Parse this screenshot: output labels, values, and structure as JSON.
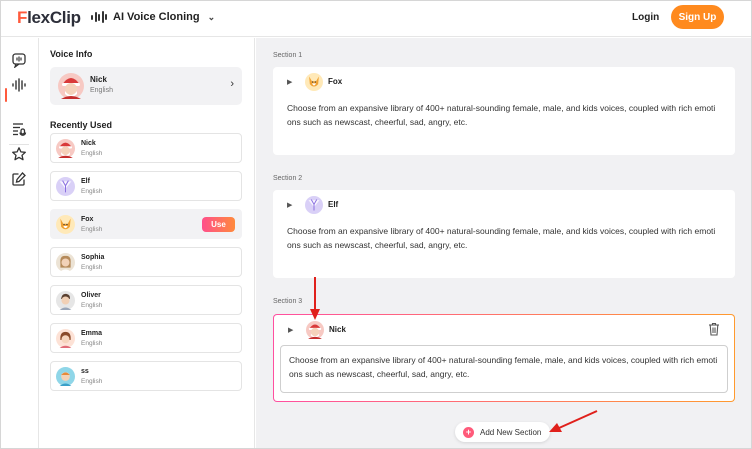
{
  "header": {
    "logo_prefix": "F",
    "logo_rest": "lexClip",
    "tool_name": "AI Voice Cloning",
    "login_label": "Login",
    "signup_label": "Sign Up"
  },
  "rail": {
    "items": [
      {
        "icon": "voice-chat-icon",
        "active": true
      },
      {
        "icon": "soundwave-icon",
        "active": false
      },
      {
        "icon": "script-icon",
        "active": false
      },
      {
        "icon": "star-icon",
        "active": false
      },
      {
        "icon": "edit-icon",
        "active": false
      }
    ]
  },
  "panel": {
    "voice_info_title": "Voice Info",
    "current_voice": {
      "name": "Nick",
      "lang": "English",
      "avatar": "nick"
    },
    "recent_title": "Recently Used",
    "use_label": "Use",
    "voices": [
      {
        "name": "Nick",
        "lang": "English",
        "avatar": "nick",
        "selected": false
      },
      {
        "name": "Elf",
        "lang": "English",
        "avatar": "elf",
        "selected": false
      },
      {
        "name": "Fox",
        "lang": "English",
        "avatar": "fox",
        "selected": true
      },
      {
        "name": "Sophia",
        "lang": "English",
        "avatar": "sophia",
        "selected": false
      },
      {
        "name": "Oliver",
        "lang": "English",
        "avatar": "oliver",
        "selected": false
      },
      {
        "name": "Emma",
        "lang": "English",
        "avatar": "emma",
        "selected": false
      },
      {
        "name": "ss",
        "lang": "English",
        "avatar": "ss",
        "selected": false
      }
    ]
  },
  "sections": [
    {
      "label": "Section 1",
      "voice": "Fox",
      "avatar": "fox",
      "active": false,
      "text": "Choose from an expansive library of 400+ natural-sounding female, male, and kids voices, coupled with rich emotions such as newscast, cheerful, sad, angry, etc."
    },
    {
      "label": "Section 2",
      "voice": "Elf",
      "avatar": "elf",
      "active": false,
      "text": "Choose from an expansive library of 400+ natural-sounding female, male, and kids voices, coupled with rich emotions such as newscast, cheerful, sad, angry, etc."
    },
    {
      "label": "Section 3",
      "voice": "Nick",
      "avatar": "nick",
      "active": true,
      "text": "Choose from an expansive library of 400+ natural-sounding female, male, and kids voices, coupled with rich emotions such as newscast, cheerful, sad, angry, etc."
    }
  ],
  "add_section_label": "Add New Section",
  "colors": {
    "brand": "#ff5a3c",
    "signup": "#ff8a1e",
    "annotation_arrow": "#e0201b"
  }
}
